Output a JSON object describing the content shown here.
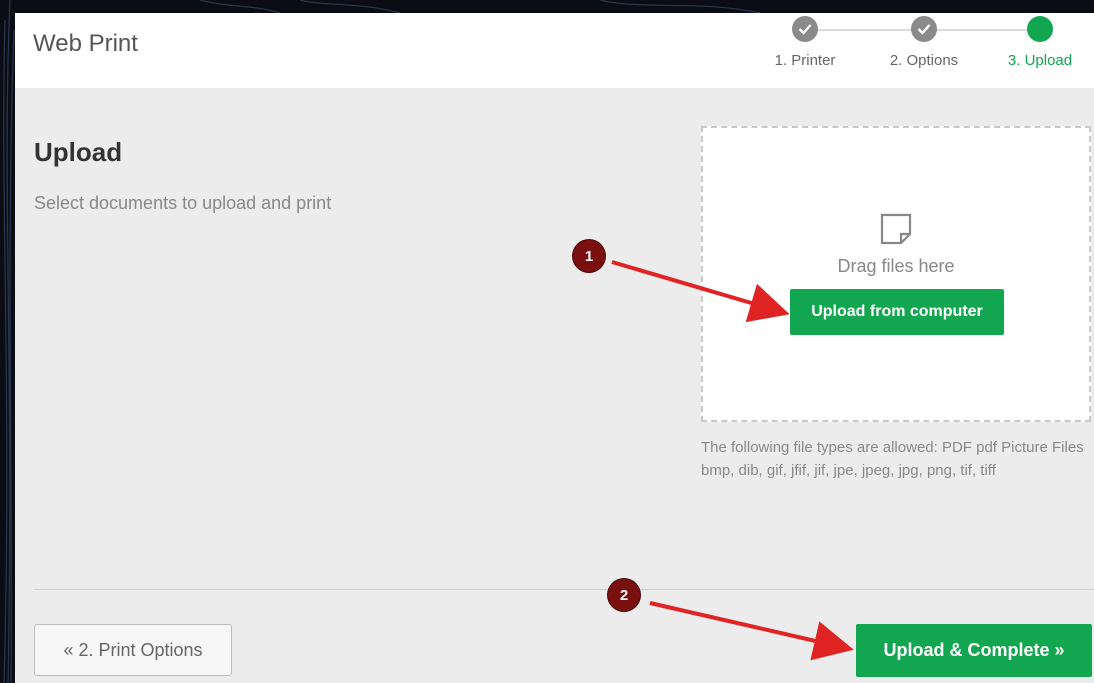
{
  "app": {
    "title": "Web Print"
  },
  "steps": [
    {
      "label": "1. Printer",
      "state": "done"
    },
    {
      "label": "2. Options",
      "state": "done"
    },
    {
      "label": "3. Upload",
      "state": "active"
    }
  ],
  "main": {
    "heading": "Upload",
    "description": "Select documents to upload and print"
  },
  "dropzone": {
    "icon": "file-icon",
    "drag_text": "Drag files here",
    "upload_button": "Upload from computer"
  },
  "allowed_types": "The following file types are allowed: PDF pdf Picture Files bmp, dib, gif, jfif, jif, jpe, jpeg, jpg, png, tif, tiff",
  "footer": {
    "back_button": "« 2. Print Options",
    "complete_button": "Upload & Complete »"
  },
  "annotations": [
    {
      "number": "1"
    },
    {
      "number": "2"
    }
  ],
  "colors": {
    "accent": "#12a650",
    "done_step": "#8a8a8a",
    "annotation_badge": "#7a0f0f",
    "annotation_arrow": "#e02424"
  }
}
